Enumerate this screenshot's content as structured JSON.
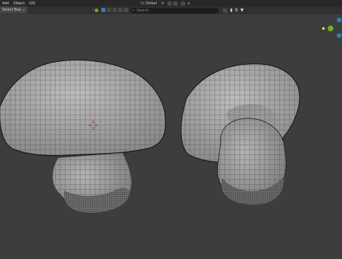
{
  "menu": {
    "items": [
      "Add",
      "Object",
      "GIS"
    ]
  },
  "header": {
    "mode_label": "Select Box",
    "transform_orientation": "Global"
  },
  "search": {
    "placeholder": "Search"
  },
  "colors": {
    "background": "#3d3d3d",
    "accent": "#4772b3",
    "mesh": "#a9a9a9",
    "wire": "#2a2a2a",
    "axis_x": "#dd3344",
    "axis_y": "#6fae2a",
    "axis_z": "#2e7ed4"
  },
  "icons": [
    "snap-icon",
    "proportional-edit-icon",
    "filter-icon",
    "camera-icon",
    "light-icon",
    "cursor-icon"
  ]
}
